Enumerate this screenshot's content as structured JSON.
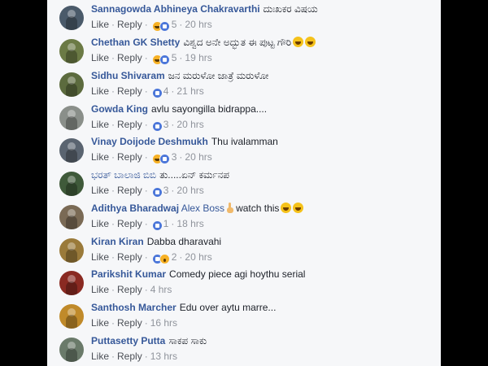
{
  "labels": {
    "like": "Like",
    "reply": "Reply",
    "dot": "·"
  },
  "colors": {
    "name": "#365899",
    "meta": "#90949c",
    "background": "#f6f7f9"
  },
  "comments": [
    {
      "name": "Sannagowda Abhineya Chakravarthi",
      "text": "ದುಃಖಕರ ವಿಷಯ",
      "reactions": [
        "haha-icon",
        "like-icon"
      ],
      "count": "5",
      "time": "20 hrs",
      "avatar_color": "#4a5a6a"
    },
    {
      "name": "Chethan GK Shetty",
      "text": "ವಿಶ್ವದ ಅನೇ ಅದ್ಭುತ ಈ ಪುಟ್ಟ ಗೌರಿ",
      "emoji": [
        "laughing-emoji",
        "laughing-emoji"
      ],
      "reactions": [
        "haha-icon",
        "like-icon"
      ],
      "count": "5",
      "time": "19 hrs",
      "avatar_color": "#6b7a45"
    },
    {
      "name": "Sidhu Shivaram",
      "text": "ಜನ ಮರುಳೋ ಜಾತ್ರೆ ಮರುಳೋ",
      "reactions": [
        "like-icon"
      ],
      "count": "4",
      "time": "21 hrs",
      "avatar_color": "#5c6b3e"
    },
    {
      "name": "Gowda King",
      "text": "avlu sayongilla bidrappa....",
      "reactions": [
        "like-icon"
      ],
      "count": "3",
      "time": "20 hrs",
      "avatar_color": "#8a8f8a"
    },
    {
      "name": "Vinay Doijode Deshmukh",
      "text": "Thu ivalamman",
      "reactions": [
        "haha-icon",
        "like-icon"
      ],
      "count": "3",
      "time": "20 hrs",
      "avatar_color": "#5a6470"
    },
    {
      "name": "ಭರತ್ ಬಾಲಾಜಿ ಬಿಬಿ",
      "text": "ತು.....ಏನ್ ಕರ್ಮನಪ",
      "reactions": [
        "like-icon"
      ],
      "count": "3",
      "time": "20 hrs",
      "avatar_color": "#3f5a3a",
      "name_plain": true
    },
    {
      "name": "Adithya Bharadwaj",
      "mention": "Alex Boss",
      "text": "watch this",
      "pre_emoji": "pointing-hand-emoji",
      "emoji": [
        "laughing-emoji",
        "laughing-emoji"
      ],
      "reactions": [
        "like-icon"
      ],
      "count": "1",
      "time": "18 hrs",
      "avatar_color": "#7a6a55"
    },
    {
      "name": "Kiran Kiran",
      "text": "Dabba dharavahi",
      "reactions": [
        "like-icon",
        "wow-icon"
      ],
      "count": "2",
      "time": "20 hrs",
      "avatar_color": "#9a7a3a"
    },
    {
      "name": "Parikshit Kumar",
      "text": "Comedy piece agi hoythu serial",
      "reactions": [],
      "count": "",
      "time": "4 hrs",
      "avatar_color": "#8a2a22"
    },
    {
      "name": "Santhosh Marcher",
      "text": "Edu over aytu marre...",
      "reactions": [],
      "count": "",
      "time": "16 hrs",
      "avatar_color": "#c08a2a"
    },
    {
      "name": "Puttasetty Putta",
      "text": "ಸಾಕಪ ಸಾಕು",
      "reactions": [],
      "count": "",
      "time": "13 hrs",
      "avatar_color": "#6a7a6a"
    }
  ]
}
